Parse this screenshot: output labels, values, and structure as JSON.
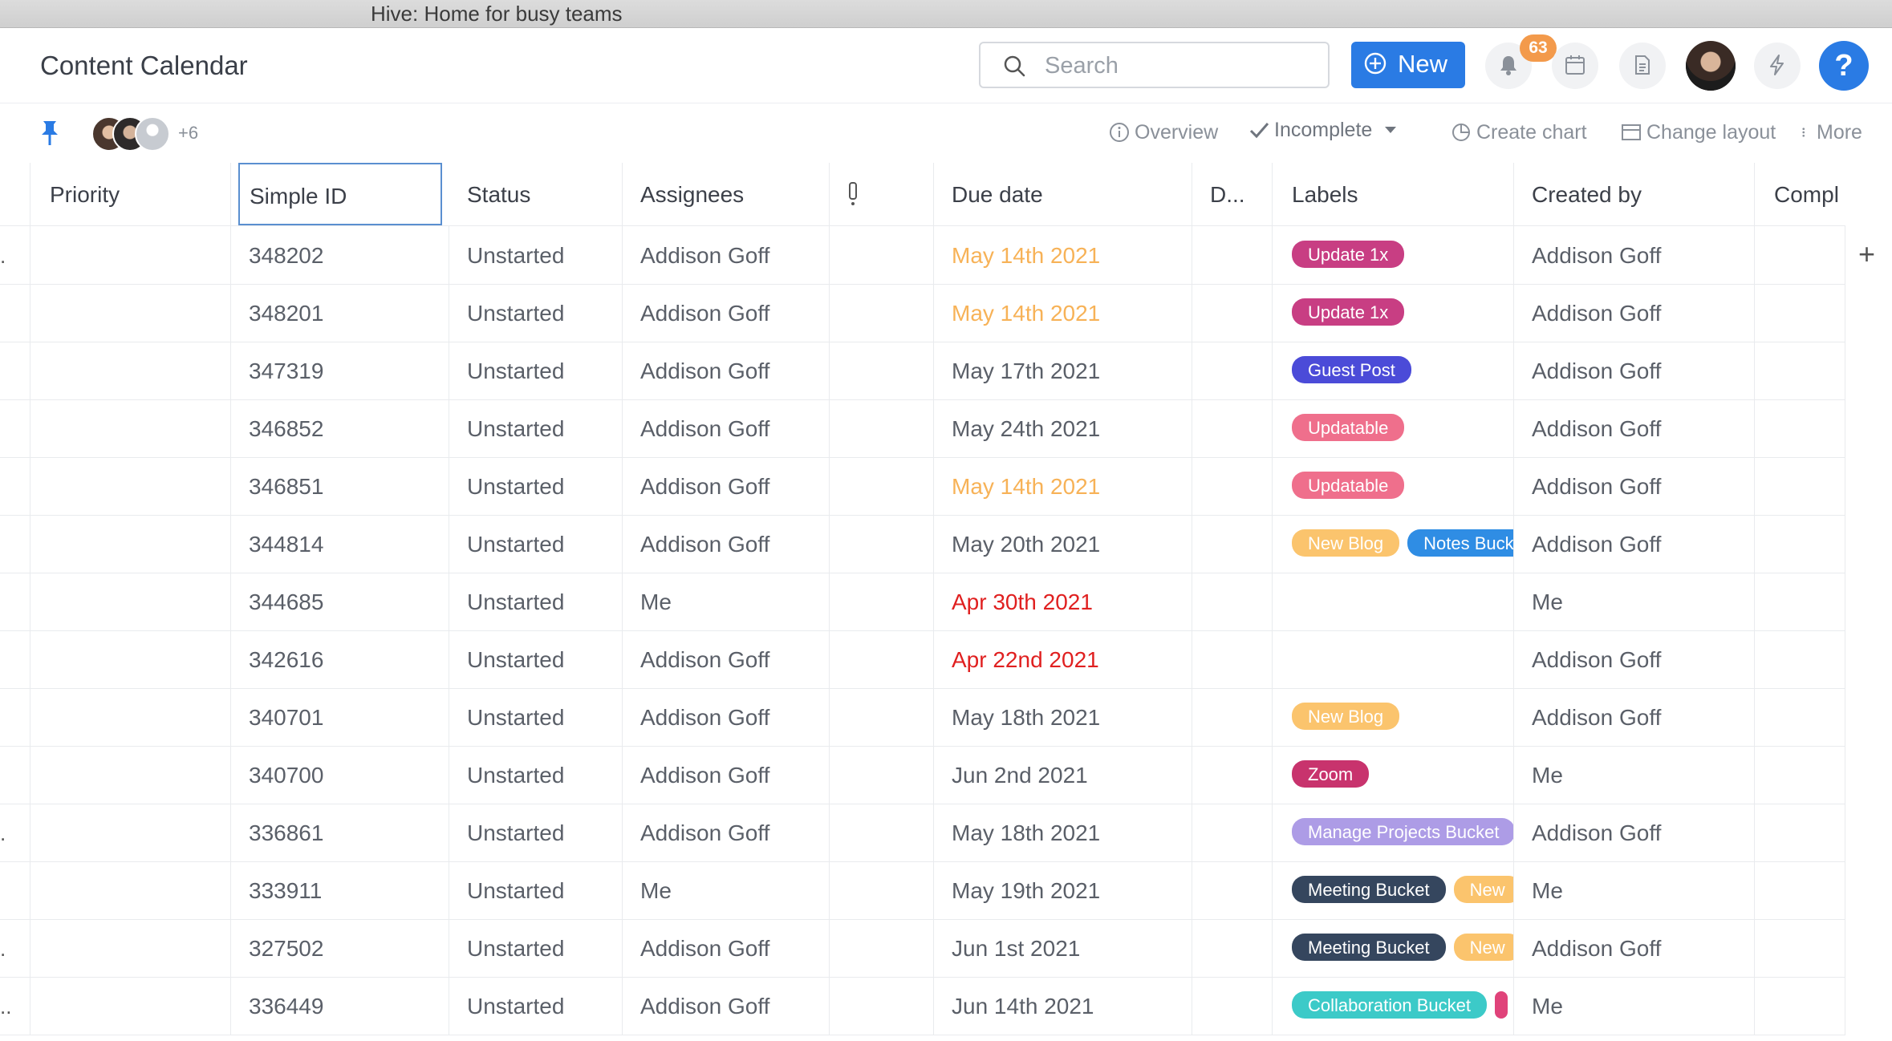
{
  "window_title": "Hive: Home for busy teams",
  "header": {
    "page_title": "Content Calendar",
    "search_placeholder": "Search",
    "new_label": "New",
    "notification_count": "63",
    "help_label": "?"
  },
  "toolbar": {
    "more_members": "+6",
    "overview": "Overview",
    "filter": "Incomplete",
    "create_chart": "Create chart",
    "change_layout": "Change layout",
    "more": "More"
  },
  "columns": {
    "priority": "Priority",
    "simple_id": "Simple ID",
    "status": "Status",
    "assignees": "Assignees",
    "due_date": "Due date",
    "d": "D...",
    "labels": "Labels",
    "created_by": "Created by",
    "completed": "Compl"
  },
  "label_colors": {
    "Update 1x": "#c83e83",
    "Guest Post": "#4b4bd8",
    "Updatable": "#ef6f8c",
    "New Blog": "#fbc46d",
    "Notes Bucket": "#2f8de4",
    "Zoom": "#c8336d",
    "Manage Projects Bucket": "#ad9ce6",
    "Meeting Bucket": "#35465e",
    "New": "#fbc46d",
    "Collaboration Bucket": "#3ccac8"
  },
  "rows": [
    {
      "lead": ".",
      "id": "348202",
      "status": "Unstarted",
      "assignee": "Addison Goff",
      "due": "May 14th 2021",
      "due_state": "due-yellow",
      "labels": [
        "Update 1x"
      ],
      "created_by": "Addison Goff"
    },
    {
      "lead": "",
      "id": "348201",
      "status": "Unstarted",
      "assignee": "Addison Goff",
      "due": "May 14th 2021",
      "due_state": "due-yellow",
      "labels": [
        "Update 1x"
      ],
      "created_by": "Addison Goff"
    },
    {
      "lead": "",
      "id": "347319",
      "status": "Unstarted",
      "assignee": "Addison Goff",
      "due": "May 17th 2021",
      "due_state": "",
      "labels": [
        "Guest Post"
      ],
      "created_by": "Addison Goff"
    },
    {
      "lead": "",
      "id": "346852",
      "status": "Unstarted",
      "assignee": "Addison Goff",
      "due": "May 24th 2021",
      "due_state": "",
      "labels": [
        "Updatable"
      ],
      "created_by": "Addison Goff"
    },
    {
      "lead": "",
      "id": "346851",
      "status": "Unstarted",
      "assignee": "Addison Goff",
      "due": "May 14th 2021",
      "due_state": "due-yellow",
      "labels": [
        "Updatable"
      ],
      "created_by": "Addison Goff"
    },
    {
      "lead": "",
      "id": "344814",
      "status": "Unstarted",
      "assignee": "Addison Goff",
      "due": "May 20th 2021",
      "due_state": "",
      "labels": [
        "New Blog",
        "Notes Bucket"
      ],
      "created_by": "Addison Goff"
    },
    {
      "lead": "",
      "id": "344685",
      "status": "Unstarted",
      "assignee": "Me",
      "due": "Apr 30th 2021",
      "due_state": "due-red",
      "labels": [],
      "created_by": "Me"
    },
    {
      "lead": "",
      "id": "342616",
      "status": "Unstarted",
      "assignee": "Addison Goff",
      "due": "Apr 22nd 2021",
      "due_state": "due-red",
      "labels": [],
      "created_by": "Addison Goff"
    },
    {
      "lead": "",
      "id": "340701",
      "status": "Unstarted",
      "assignee": "Addison Goff",
      "due": "May 18th 2021",
      "due_state": "",
      "labels": [
        "New Blog"
      ],
      "created_by": "Addison Goff"
    },
    {
      "lead": "",
      "id": "340700",
      "status": "Unstarted",
      "assignee": "Addison Goff",
      "due": "Jun 2nd 2021",
      "due_state": "",
      "labels": [
        "Zoom"
      ],
      "created_by": "Me"
    },
    {
      "lead": ".",
      "id": "336861",
      "status": "Unstarted",
      "assignee": "Addison Goff",
      "due": "May 18th 2021",
      "due_state": "",
      "labels": [
        "Manage Projects Bucket"
      ],
      "created_by": "Addison Goff"
    },
    {
      "lead": "",
      "id": "333911",
      "status": "Unstarted",
      "assignee": "Me",
      "due": "May 19th 2021",
      "due_state": "",
      "labels": [
        "Meeting Bucket",
        "New"
      ],
      "created_by": "Me"
    },
    {
      "lead": ".",
      "id": "327502",
      "status": "Unstarted",
      "assignee": "Addison Goff",
      "due": "Jun 1st 2021",
      "due_state": "",
      "labels": [
        "Meeting Bucket",
        "New"
      ],
      "created_by": "Addison Goff"
    },
    {
      "lead": "..",
      "id": "336449",
      "status": "Unstarted",
      "assignee": "Addison Goff",
      "due": "Jun 14th 2021",
      "due_state": "",
      "labels": [
        "Collaboration Bucket",
        ""
      ],
      "created_by": "Me"
    }
  ]
}
